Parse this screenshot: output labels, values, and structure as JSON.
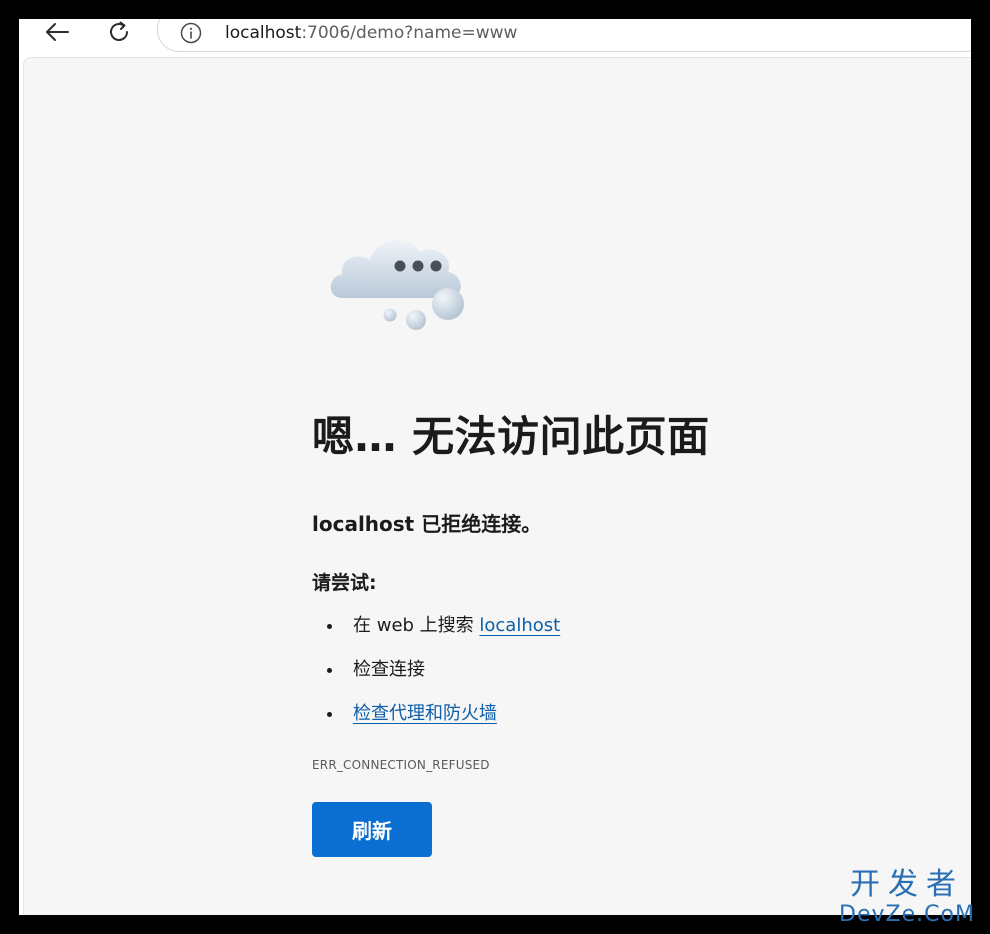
{
  "browser": {
    "address": {
      "host": "localhost",
      "rest": ":7006/demo?name=www"
    }
  },
  "error_page": {
    "headline": "嗯… 无法访问此页面",
    "subline": "localhost 已拒绝连接。",
    "try_label": "请尝试:",
    "suggestions": [
      {
        "prefix": "在 web 上搜索 ",
        "link": "localhost"
      },
      {
        "text": "检查连接"
      },
      {
        "link": "检查代理和防火墙"
      }
    ],
    "error_code": "ERR_CONNECTION_REFUSED",
    "refresh_label": "刷新"
  },
  "watermark": {
    "cn": "开发者",
    "en": "DevZe.CoM"
  },
  "colors": {
    "accent": "#0a6fd1",
    "link": "#0f5ea8",
    "page_bg": "#f6f6f6"
  }
}
